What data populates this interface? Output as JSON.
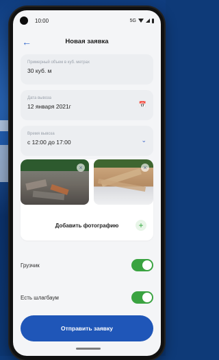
{
  "status_bar": {
    "time": "10:00",
    "network": "5G"
  },
  "header": {
    "title": "Новая заявка"
  },
  "form": {
    "volume": {
      "label": "Примерный объем в куб. метрах",
      "value": "30 куб. м"
    },
    "pickup_date": {
      "label": "Дата вывоза",
      "value": "12 января 2021г"
    },
    "pickup_time": {
      "label": "Время вывоза",
      "value": "с 12:00 до 17:00"
    }
  },
  "photos": {
    "add_label": "Добавить фотографию"
  },
  "toggles": [
    {
      "label": "Грузчик",
      "on": true
    },
    {
      "label": "Есть шлагбаум",
      "on": true
    }
  ],
  "submit": {
    "label": "Отправить заявку"
  },
  "colors": {
    "accent": "#1f56b8",
    "toggle_on": "#3aa341",
    "field_bg": "#eceef1"
  },
  "icons": {
    "back": "arrow-left-icon",
    "calendar": "calendar-icon",
    "dropdown": "chevron-down-icon",
    "remove": "close-icon",
    "add": "plus-icon"
  }
}
